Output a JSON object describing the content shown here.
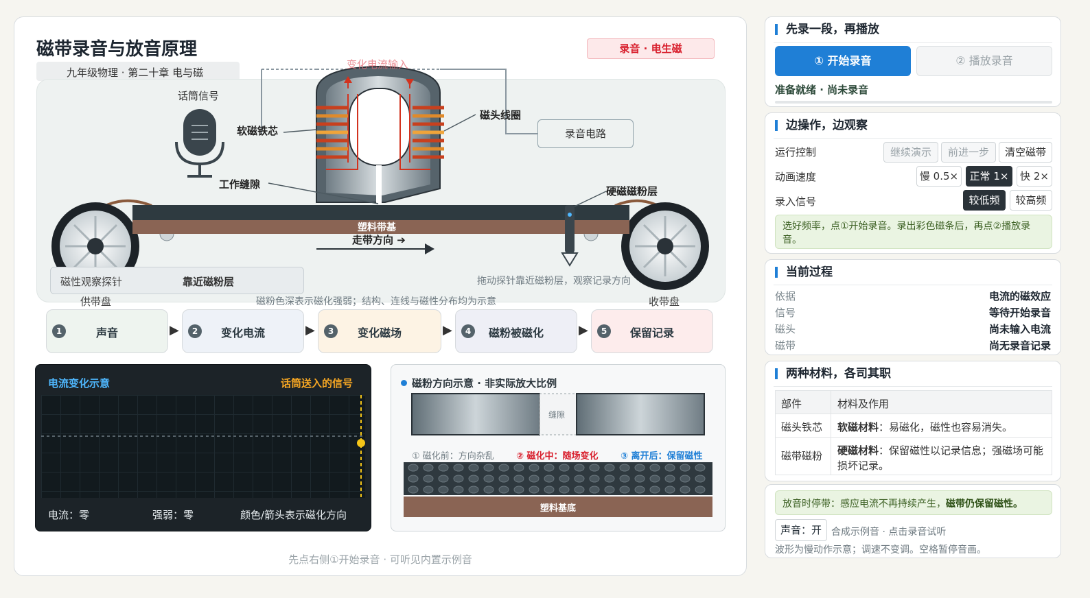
{
  "header": {
    "title": "磁带录音与放音原理",
    "subtitle": "九年级物理 · 第二十章 电与磁",
    "mode_badge": "录音 · 电生磁"
  },
  "scene": {
    "current_in_label": "变化电流输入",
    "mic_label": "话筒信号",
    "soft_core_label": "软磁铁芯",
    "coil_label": "磁头线圈",
    "circuit_label": "录音电路",
    "gap_label": "工作缝隙",
    "hard_layer_label": "硬磁磁粉层",
    "base_label": "塑料带基",
    "direction_label": "走带方向 ➔",
    "probe_label": "磁性观察探针",
    "probe_value": "靠近磁粉层",
    "drag_hint": "拖动探针靠近磁粉层，观察记录方向",
    "note": "磁粉色深表示磁化强弱；结构、连线与磁性分布均为示意",
    "supply_reel": "供带盘",
    "take_reel": "收带盘"
  },
  "chain": [
    {
      "num": "1",
      "label": "声音",
      "bg": "#eef4ef"
    },
    {
      "num": "2",
      "label": "变化电流",
      "bg": "#eef2f8"
    },
    {
      "num": "3",
      "label": "变化磁场",
      "bg": "#fdf3e4"
    },
    {
      "num": "4",
      "label": "磁粉被磁化",
      "bg": "#eeeff6"
    },
    {
      "num": "5",
      "label": "保留记录",
      "bg": "#fdecec"
    }
  ],
  "scope": {
    "title": "电流变化示意",
    "signal_label": "话筒送入的信号",
    "current": "电流：零",
    "strength": "强弱：零",
    "legend": "颜色/箭头表示磁化方向"
  },
  "magnet": {
    "title": "磁粉方向示意 · 非实际放大比例",
    "gap": "缝隙",
    "before": "① 磁化前：方向杂乱",
    "during": "② 磁化中：随场变化",
    "after": "③ 离开后：保留磁性",
    "base": "塑料基底"
  },
  "footer": "先点右侧①开始录音 · 可听见内置示例音",
  "panel1": {
    "title": "先录一段，再播放",
    "record_btn": "① 开始录音",
    "play_btn": "② 播放录音",
    "status": "准备就绪 · 尚未录音",
    "progress": 0
  },
  "panel2": {
    "title": "边操作，边观察",
    "run_label": "运行控制",
    "continue_btn": "继续演示",
    "step_btn": "前进一步",
    "clear_btn": "清空磁带",
    "speed_label": "动画速度",
    "slow_btn": "慢 0.5×",
    "normal_btn": "正常 1×",
    "fast_btn": "快 2×",
    "signal_label": "录入信号",
    "low_btn": "较低频",
    "high_btn": "较高频",
    "tip": "选好频率，点①开始录音。录出彩色磁条后，再点②播放录音。"
  },
  "panel3": {
    "title": "当前过程",
    "rows": [
      {
        "k": "依据",
        "v": "电流的磁效应"
      },
      {
        "k": "信号",
        "v": "等待开始录音"
      },
      {
        "k": "磁头",
        "v": "尚未输入电流"
      },
      {
        "k": "磁带",
        "v": "尚无录音记录"
      }
    ]
  },
  "panel4": {
    "title": "两种材料，各司其职",
    "head_part": "部件",
    "head_role": "材料及作用",
    "row1_part": "磁头铁芯",
    "row1_strong": "软磁材料",
    "row1_rest": "：易磁化，磁性也容易消失。",
    "row2_part": "磁带磁粉",
    "row2_strong": "硬磁材料",
    "row2_rest": "：保留磁性以记录信息；强磁场可能损坏记录。"
  },
  "panel5": {
    "tip_plain": "放音时停带：感应电流不再持续产生，",
    "tip_bold": "磁带仍保留磁性。",
    "sound_btn": "声音：开",
    "sound_note": "合成示例音 · 点击录音试听",
    "wave_note": "波形为慢动作示意；调速不变调。空格暂停音画。"
  },
  "colors": {
    "accent": "#1f7fd6",
    "record_red": "#d81e2c",
    "signal_yellow": "#f5c518"
  }
}
